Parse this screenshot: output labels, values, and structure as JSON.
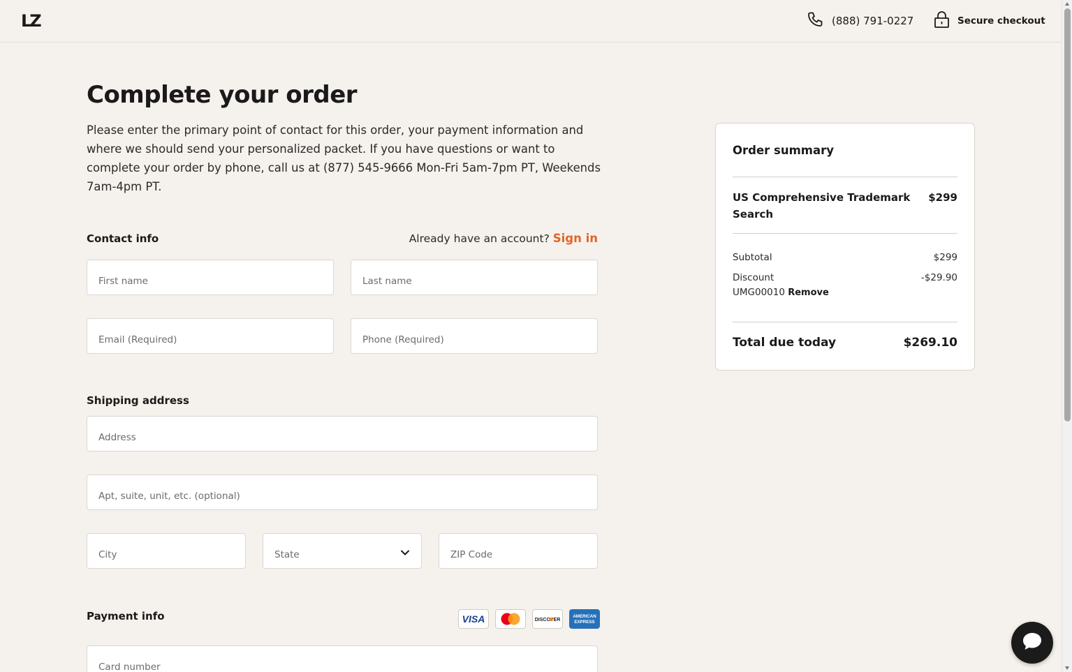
{
  "header": {
    "logo": "LZ",
    "phone": "(888) 791-0227",
    "secure_label": "Secure checkout"
  },
  "page": {
    "title": "Complete your order",
    "intro": "Please enter the primary point of contact for this order, your payment information and where we should send your personalized packet. If you have questions or want to complete your order by phone, call us at (877) 545-9666 Mon-Fri 5am-7pm PT, Weekends 7am-4pm PT."
  },
  "contact": {
    "label": "Contact info",
    "account_prompt": "Already have an account?",
    "sign_in": "Sign in",
    "first_name_placeholder": "First name",
    "last_name_placeholder": "Last name",
    "email_placeholder": "Email (Required)",
    "phone_placeholder": "Phone (Required)"
  },
  "shipping": {
    "label": "Shipping address",
    "address_placeholder": "Address",
    "apt_placeholder": "Apt, suite, unit, etc. (optional)",
    "city_placeholder": "City",
    "state_placeholder": "State",
    "zip_placeholder": "ZIP Code"
  },
  "payment": {
    "label": "Payment info",
    "cards": [
      "VISA",
      "Mastercard",
      "DISCOVER",
      "AMERICAN EXPRESS"
    ],
    "card_number_placeholder": "Card number"
  },
  "summary": {
    "title": "Order summary",
    "item_name": "US Comprehensive Trademark Search",
    "item_price": "$299",
    "subtotal_label": "Subtotal",
    "subtotal_value": "$299",
    "discount_label": "Discount",
    "discount_value": "-$29.90",
    "discount_code": "UMG00010",
    "remove_label": "Remove",
    "total_label": "Total due today",
    "total_value": "$269.10"
  },
  "colors": {
    "background": "#f5f1ec",
    "accent": "#e3652a",
    "chat_button": "#1b1b1b"
  }
}
